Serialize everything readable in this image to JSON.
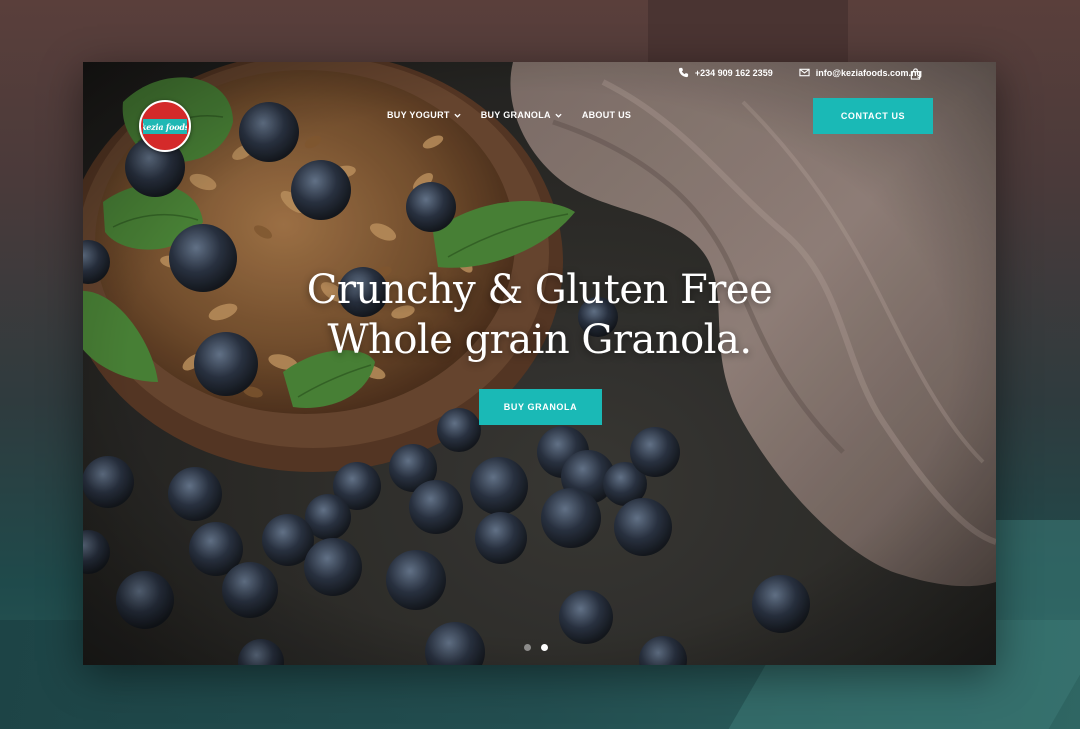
{
  "header": {
    "phone": "+234 909 162 2359",
    "email": "info@keziafoods.com.ng",
    "logo_text": "kezia foods"
  },
  "nav": {
    "items": [
      {
        "label": "BUY YOGURT",
        "has_dropdown": true
      },
      {
        "label": "BUY GRANOLA",
        "has_dropdown": true
      },
      {
        "label": "ABOUT US",
        "has_dropdown": false
      }
    ],
    "contact_label": "CONTACT US"
  },
  "hero": {
    "title_line1": "Crunchy & Gluten Free",
    "title_line2": "Whole grain Granola.",
    "cta_label": "BUY GRANOLA"
  },
  "slider": {
    "count": 2,
    "active_index": 1
  },
  "colors": {
    "accent": "#1ab9b6",
    "logo_red": "#d42a2a",
    "text": "#ffffff"
  },
  "icons": {
    "phone": "phone-icon",
    "email": "envelope-icon",
    "cart": "shopping-bag-icon",
    "dropdown": "chevron-down-icon"
  }
}
